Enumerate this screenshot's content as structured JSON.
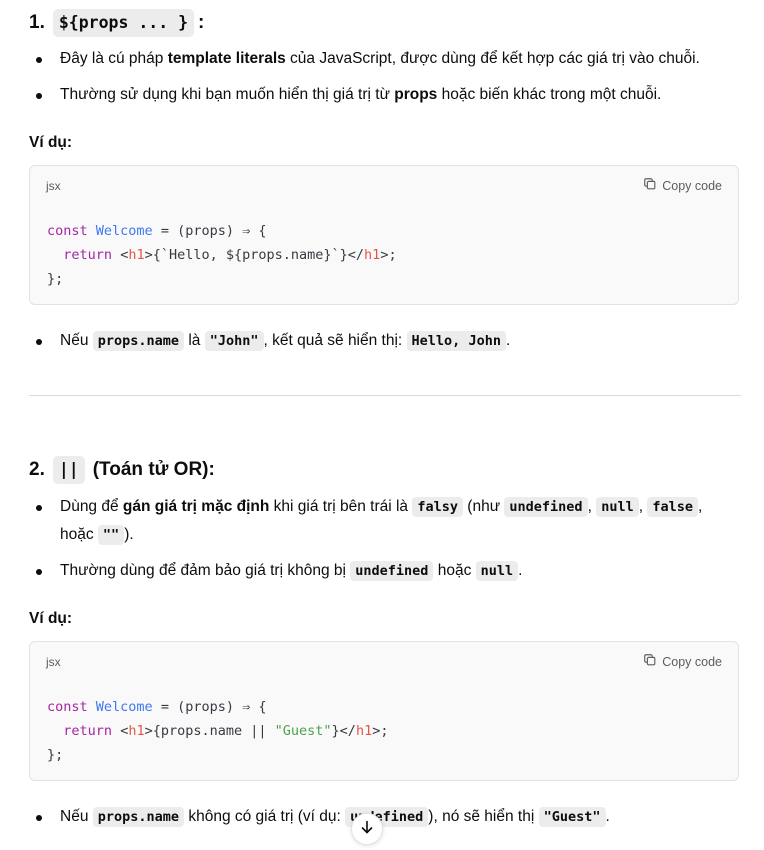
{
  "section1": {
    "number": "1.",
    "heading_code": "${props ... }",
    "heading_suffix": ":",
    "bullets": [
      {
        "pre": "Đây là cú pháp ",
        "bold": "template literals",
        "post": " của JavaScript, được dùng để kết hợp các giá trị vào chuỗi."
      },
      {
        "pre": "Thường sử dụng khi bạn muốn hiển thị giá trị từ ",
        "bold": "props",
        "post": " hoặc biến khác trong một chuỗi."
      }
    ],
    "example_label": "Ví dụ:",
    "code": {
      "lang": "jsx",
      "copy_label": "Copy code",
      "line1": {
        "kw": "const",
        "fn": "Welcome",
        "rest": " = (props) ⇒ {"
      },
      "line2": {
        "kw": "return",
        "lt": "<",
        "tag": "h1",
        "mid": ">{`Hello, ${props.name}`}</",
        "tag2": "h1",
        "end": ">;"
      },
      "line3": "};"
    },
    "result": {
      "pre": "Nếu ",
      "code1": "props.name",
      "mid1": " là ",
      "code2": "\"John\"",
      "mid2": ", kết quả sẽ hiển thị: ",
      "code3": "Hello, John",
      "post": "."
    }
  },
  "section2": {
    "number": "2.",
    "heading_code": "||",
    "heading_suffix": "(Toán tử OR):",
    "bullets": [
      {
        "pre": "Dùng để ",
        "bold": "gán giá trị mặc định",
        "mid": " khi giá trị bên trái là ",
        "c1": "falsy",
        "m2": " (như ",
        "c2": "undefined",
        "m3": ", ",
        "c3": "null",
        "m4": ", ",
        "c4": "false",
        "m5": ",",
        "line2_pre": "hoặc ",
        "c5": "\"\"",
        "line2_post": ")."
      },
      {
        "pre": "Thường dùng để đảm bảo giá trị không bị ",
        "c1": "undefined",
        "mid": " hoặc ",
        "c2": "null",
        "post": "."
      }
    ],
    "example_label": "Ví dụ:",
    "code": {
      "lang": "jsx",
      "copy_label": "Copy code",
      "line1": {
        "kw": "const",
        "fn": "Welcome",
        "rest": " = (props) ⇒ {"
      },
      "line2": {
        "kw": "return",
        "lt": "<",
        "tag": "h1",
        "mid": ">{props.name || ",
        "str": "\"Guest\"",
        "mid2": "}</",
        "tag2": "h1",
        "end": ">;"
      },
      "line3": "};"
    },
    "result": {
      "pre": "Nếu ",
      "code1": "props.name",
      "mid1": " không có giá trị (ví dụ: ",
      "code2": "undefined",
      "mid2": "), nó sẽ hiển thị ",
      "code3": "\"Guest\"",
      "post": "."
    }
  },
  "icons": {
    "copy": "copy-icon",
    "scroll": "arrow-down-icon"
  }
}
